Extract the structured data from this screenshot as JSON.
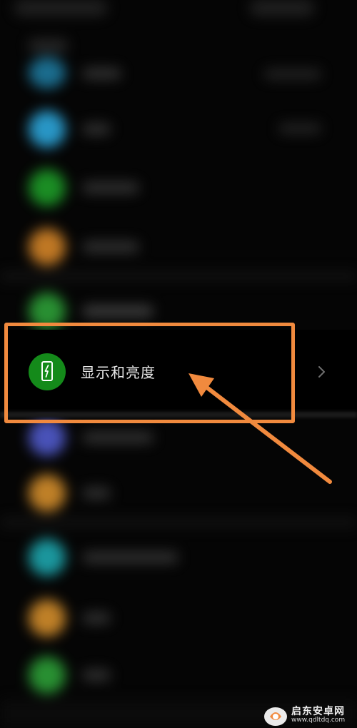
{
  "settings": {
    "focused_item": {
      "label": "显示和亮度",
      "icon": "display-brightness-icon",
      "icon_color": "#148a1a"
    },
    "blurred_item_icon_colors": [
      "#1f7fa6",
      "#2fb0e8",
      "#1fa52a",
      "#e08c2a",
      "#2fa83a",
      "#5560d8",
      "#e0962e",
      "#1fb0b8",
      "#e0962e",
      "#2fa83a"
    ]
  },
  "annotation": {
    "highlight_color": "#f18a3e",
    "arrow_color": "#f18a3e"
  },
  "watermark": {
    "name": "启东安卓网",
    "url": "www.qdltdq.com"
  }
}
